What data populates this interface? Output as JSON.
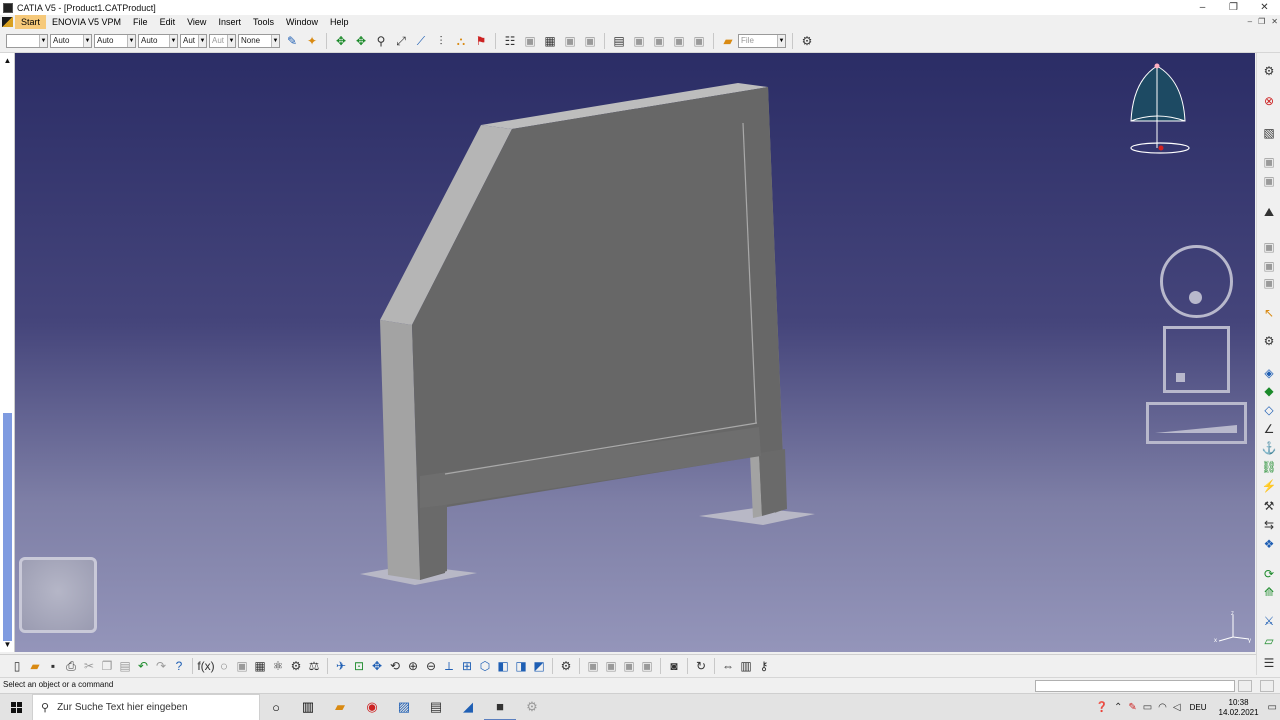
{
  "window": {
    "title": "CATIA V5 - [Product1.CATProduct]",
    "controls": [
      "–",
      "❐",
      "✕"
    ]
  },
  "menu": {
    "items": [
      "Start",
      "ENOVIA V5 VPM",
      "File",
      "Edit",
      "View",
      "Insert",
      "Tools",
      "Window",
      "Help"
    ],
    "active": "Start"
  },
  "toolbar_top": {
    "combos": [
      {
        "value": "",
        "disabled": false
      },
      {
        "value": "Auto",
        "disabled": false
      },
      {
        "value": "Auto",
        "disabled": false
      },
      {
        "value": "Auto",
        "disabled": false
      },
      {
        "value": "Aut",
        "disabled": false
      },
      {
        "value": "Aut",
        "disabled": true
      },
      {
        "value": "None",
        "disabled": false
      }
    ],
    "file_combo": "File"
  },
  "status": {
    "message": "Select an object or a command"
  },
  "taskbar": {
    "search_placeholder": "Zur Suche Text hier eingeben",
    "language": "DEU",
    "time": "10:38",
    "date": "14.02.2021"
  },
  "axis_labels": {
    "z": "z",
    "x": "x",
    "y": "y"
  },
  "colors": {
    "viewport_top": "#2b2d66",
    "viewport_bottom": "#9495ba",
    "model_face": "#666666",
    "model_side": "#9f9f9f",
    "model_top": "#b4b4b4",
    "menu_active": "#f6c97a",
    "compass_fill": "#1d4a63"
  }
}
